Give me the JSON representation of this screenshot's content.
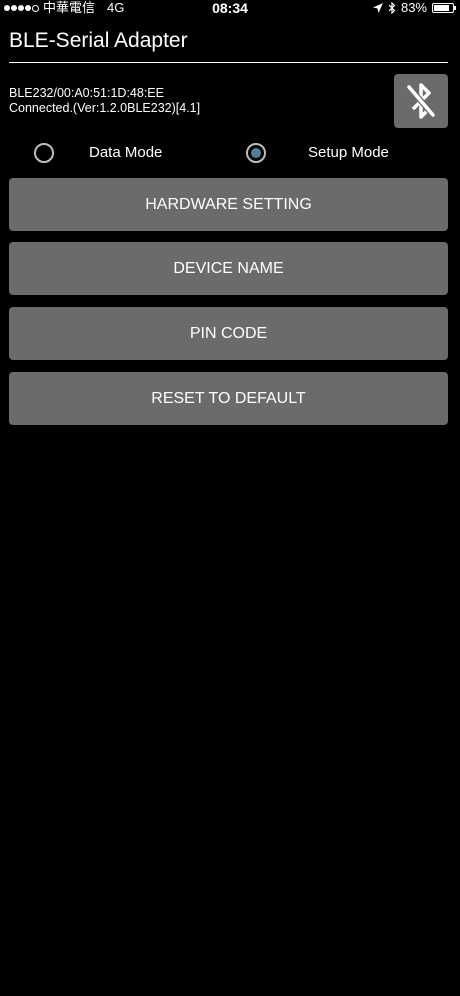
{
  "status_bar": {
    "carrier": "中華電信",
    "network": "4G",
    "time": "08:34",
    "battery_percent": "83%",
    "battery_level": 0.83
  },
  "app": {
    "title": "BLE-Serial Adapter"
  },
  "device": {
    "address": "BLE232/00:A0:51:1D:48:EE",
    "status": "Connected.(Ver:1.2.0BLE232)[4.1]"
  },
  "modes": {
    "data_label": "Data Mode",
    "setup_label": "Setup Mode",
    "selected": "setup"
  },
  "buttons": {
    "hardware_setting": "HARDWARE SETTING",
    "device_name": "DEVICE NAME",
    "pin_code": "PIN CODE",
    "reset_default": "RESET TO DEFAULT"
  },
  "colors": {
    "background": "#000000",
    "button": "#6b6b6b",
    "radio_accent": "#4e7f9e"
  }
}
